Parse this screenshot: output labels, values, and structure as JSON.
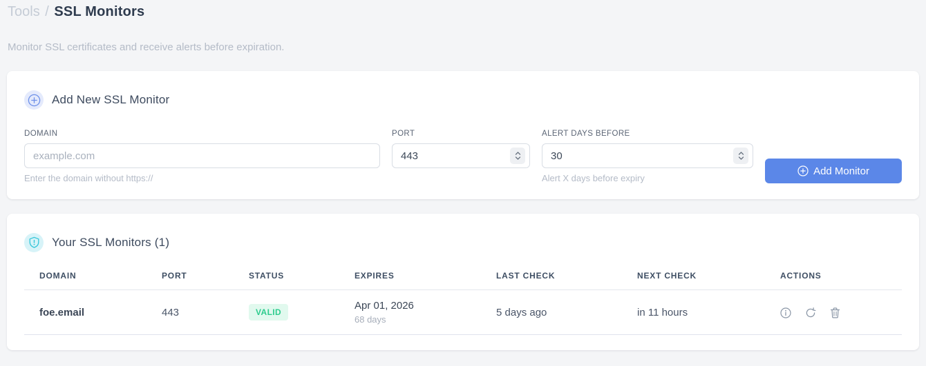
{
  "header": {
    "breadcrumb_section": "Tools",
    "breadcrumb_separator": "/",
    "breadcrumb_current": "SSL Monitors",
    "subtitle": "Monitor SSL certificates and receive alerts before expiration."
  },
  "add_monitor_card": {
    "title": "Add New SSL Monitor",
    "icon": "plus-circle-icon",
    "fields": {
      "domain": {
        "label": "DOMAIN",
        "value": "",
        "placeholder": "example.com",
        "helper": "Enter the domain without https://"
      },
      "port": {
        "label": "PORT",
        "value": "443"
      },
      "alert_days": {
        "label": "ALERT DAYS BEFORE",
        "value": "30",
        "helper": "Alert X days before expiry"
      }
    },
    "submit_label": "Add Monitor",
    "submit_icon": "plus-circle-icon"
  },
  "monitors_card": {
    "title": "Your SSL Monitors (1)",
    "icon": "shield-icon",
    "count": 1,
    "table": {
      "headers": [
        "DOMAIN",
        "PORT",
        "STATUS",
        "EXPIRES",
        "LAST CHECK",
        "NEXT CHECK",
        "ACTIONS"
      ],
      "rows": [
        {
          "domain": "foe.email",
          "port": "443",
          "status": "VALID",
          "expires_date": "Apr 01, 2026",
          "expires_days": "68 days",
          "last_check": "5 days ago",
          "next_check": "in 11 hours",
          "actions": [
            "info-icon",
            "refresh-icon",
            "trash-icon"
          ]
        }
      ]
    }
  },
  "colors": {
    "accent_blue": "#5b87e8",
    "link_blue": "#6b93ea",
    "valid_green": "#2ecc8e",
    "valid_bg": "#e1f9ee",
    "shield_cyan": "#35c6d9",
    "page_bg": "#f4f5f7"
  }
}
